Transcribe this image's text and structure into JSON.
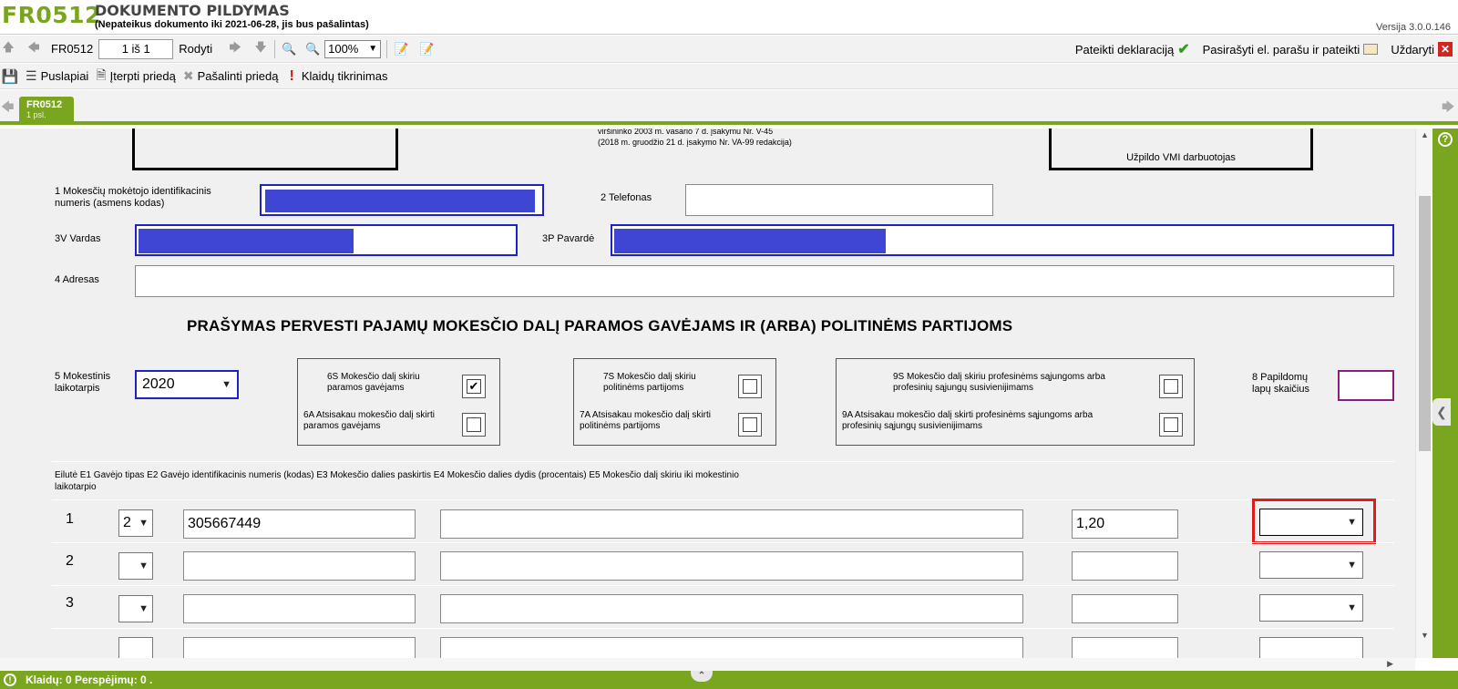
{
  "header": {
    "code": "FR0512",
    "title": "DOKUMENTO PILDYMAS",
    "subtitle": "(Nepateikus dokumento iki 2021-06-28, jis bus pašalintas)",
    "version": "Versija 3.0.0.146"
  },
  "toolbar": {
    "form_code": "FR0512",
    "page_value": "1 iš 1",
    "show_label": "Rodyti",
    "zoom": "100%",
    "submit_label": "Pateikti deklaraciją",
    "sign_submit_label": "Pasirašyti el. parašu ir pateikti",
    "close_label": "Uždaryti"
  },
  "toolbar2": {
    "pages_label": "Puslapiai",
    "insert_label": "Įterpti priedą",
    "remove_label": "Pašalinti priedą",
    "errors_label": "Klaidų tikrinimas"
  },
  "tab": {
    "name": "FR0512",
    "pages": "1 psl."
  },
  "form": {
    "order_text_1": "viršininko 2003 m. vasario 7 d. įsakymu Nr. V-45",
    "order_text_2": "(2018 m. gruodžio 21 d. įsakymo Nr. VA-99 redakcija)",
    "vmi_label": "Užpildo VMI darbuotojas",
    "f1_label": "1 Mokesčių mokėtojo identifikacinis numeris (asmens kodas)",
    "f2_label": "2 Telefonas",
    "f3v_label": "3V Vardas",
    "f3p_label": "3P Pavardė",
    "f4_label": "4 Adresas",
    "heading": "PRAŠYMAS PERVESTI PAJAMŲ MOKESČIO DALĮ PARAMOS GAVĖJAMS IR (ARBA) POLITINĖMS PARTIJOMS",
    "f5_label": "5 Mokestinis laikotarpis",
    "f5_value": "2020",
    "g6s": "6S Mokesčio dalį skiriu paramos gavėjams",
    "g6a": "6A Atsisakau mokesčio dalį skirti paramos gavėjams",
    "g7s": "7S Mokesčio dalį skiriu politinėms partijoms",
    "g7a": "7A Atsisakau mokesčio dalį skirti politinėms partijoms",
    "g9s": "9S Mokesčio dalį skiriu profesinėms sąjungoms arba profesinių sąjungų susivienijimams",
    "g9a": "9A Atsisakau mokesčio dalį skirti profesinėms sąjungoms arba profesinių sąjungų susivienijimams",
    "f8_label": "8 Papildomų lapų skaičius",
    "table_header": "Eilutė E1 Gavėjo tipas E2 Gavėjo identifikacinis numeris (kodas) E3 Mokesčio dalies paskirtis E4 Mokesčio dalies dydis (procentais) E5 Mokesčio dalį skiriu iki mokestinio laikotarpio",
    "check_6s": "✔"
  },
  "rows": [
    {
      "num": "1",
      "type": "2",
      "code": "305667449",
      "purpose": "",
      "percent": "1,20",
      "until": ""
    },
    {
      "num": "2",
      "type": "",
      "code": "",
      "purpose": "",
      "percent": "",
      "until": ""
    },
    {
      "num": "3",
      "type": "",
      "code": "",
      "purpose": "",
      "percent": "",
      "until": ""
    }
  ],
  "status": {
    "text": "Klaidų: 0 Perspėjimų: 0 ."
  }
}
